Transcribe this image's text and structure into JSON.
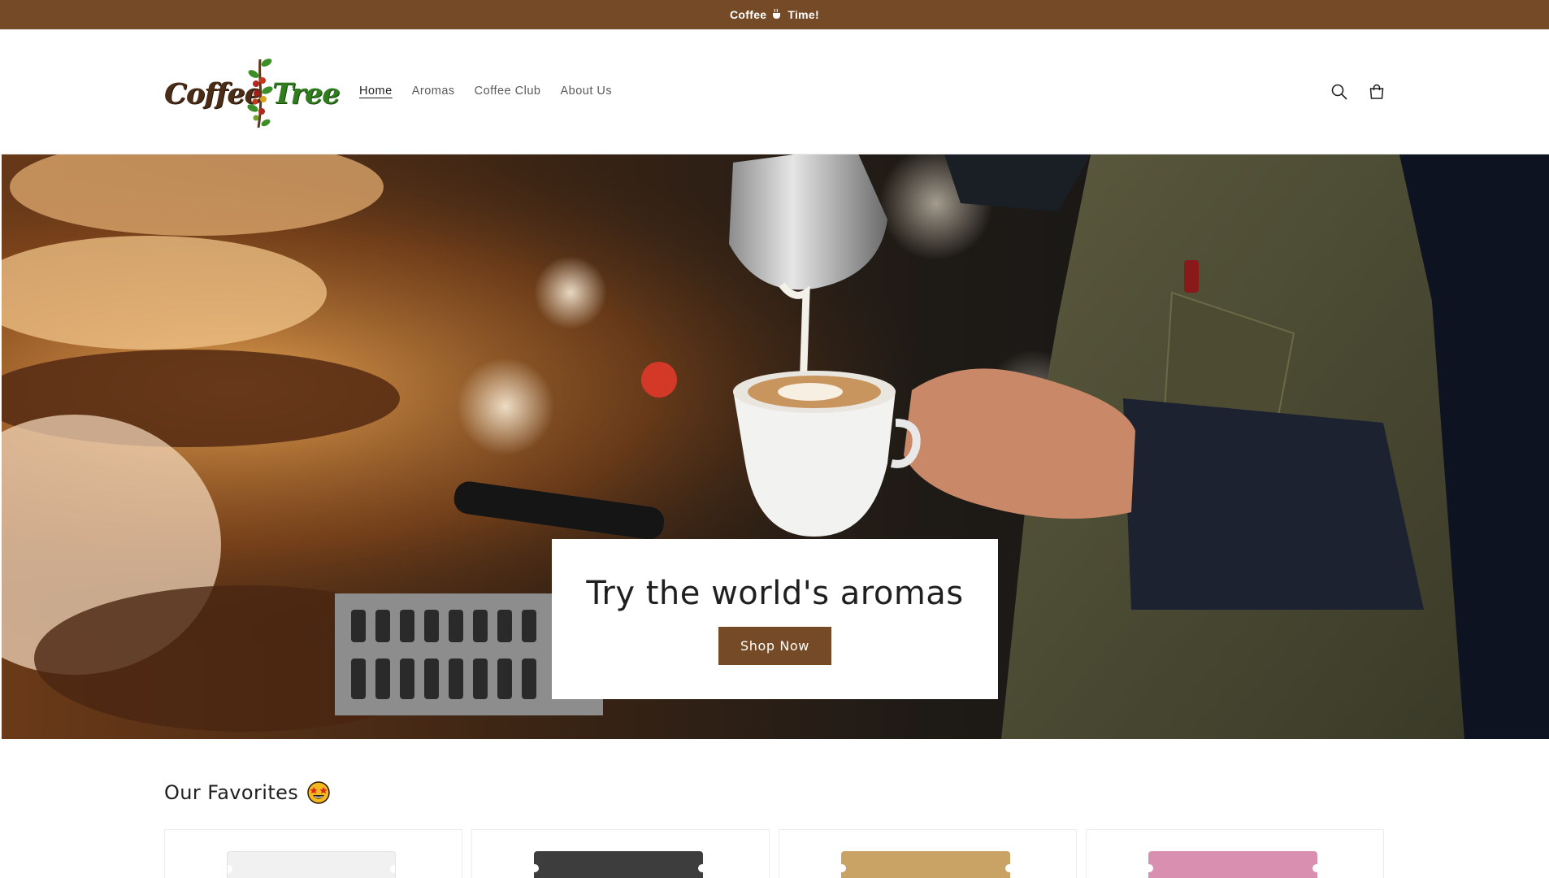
{
  "announcement": {
    "text_before": "Coffee",
    "text_after": "Time!",
    "icon": "coffee-cup-icon"
  },
  "brand": {
    "logo_word_1": "Coffee",
    "logo_word_2": "Tree"
  },
  "nav": {
    "items": [
      {
        "label": "Home",
        "active": true
      },
      {
        "label": "Aromas",
        "active": false
      },
      {
        "label": "Coffee Club",
        "active": false
      },
      {
        "label": "About Us",
        "active": false
      }
    ]
  },
  "header_icons": [
    "search-icon",
    "cart-icon"
  ],
  "hero": {
    "heading": "Try the world's aromas",
    "cta_label": "Shop Now"
  },
  "favorites": {
    "title": "Our Favorites",
    "emoji": "star-struck-face-icon",
    "products": [
      {
        "bag_color": "#f1f1f1"
      },
      {
        "bag_color": "#3d3d3d"
      },
      {
        "bag_color": "#c9a266"
      },
      {
        "bag_color": "#d98fb0"
      }
    ]
  },
  "colors": {
    "accent": "#754b27",
    "text": "#1f1f1f",
    "nav_text": "#5a5a5a"
  }
}
